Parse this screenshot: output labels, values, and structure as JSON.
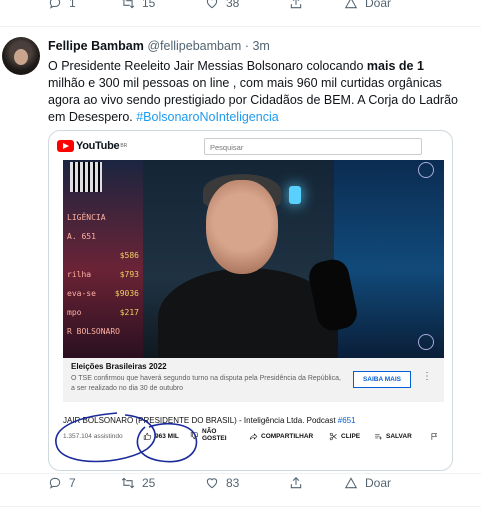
{
  "top_actions": {
    "replies": "1",
    "retweets": "15",
    "likes": "38",
    "donate": "Doar"
  },
  "tweet": {
    "name": "Fellipe Bambam",
    "handle": "@fellipebambam",
    "separator": "·",
    "time": "3m",
    "text_before": "O Presidente Reeleito Jair Messias Bolsonaro colocando ",
    "text_bold": "mais de 1",
    "text_after": " milhão e 300 mil pessoas on line , com mais 960 mil curtidas orgânicas agora ao vivo sendo prestigiado por Cidadãos de BEM. A Corja do Ladrão em Desespero. ",
    "hashtag": "#BolsonaroNoInteligencia"
  },
  "youtube": {
    "logo_text": "YouTube",
    "logo_sup": "BR",
    "search_placeholder": "Pesquisar",
    "video_overlay": {
      "header_lines": [
        "LIGÊNCIA",
        "A. 651"
      ],
      "rows": [
        {
          "label": "",
          "value": "$586"
        },
        {
          "label": "rilha",
          "value": "$793"
        },
        {
          "label": "eva-se",
          "value": "$9036"
        },
        {
          "label": "mpo",
          "value": "$217"
        }
      ],
      "footer": "R BOLSONARO"
    },
    "banner": {
      "title": "Eleições Brasileiras 2022",
      "text": "O TSE confirmou que haverá segundo turno na disputa pela Presidência da República, a ser realizado no dia 30 de outubro",
      "button": "SAIBA MAIS",
      "more": "⋮"
    },
    "video_title": "JAIR BOLSONARO (PRESIDENTE DO BRASIL) - Inteligência Ltda. Podcast ",
    "video_title_tag": "#651",
    "views": "1.357.104 assistindo",
    "like_count": "963 MIL",
    "dislike_label_1": "NÃO",
    "dislike_label_2": "GOSTEI",
    "share_label": "COMPARTILHAR",
    "clip_label": "CLIPE",
    "save_label": "SALVAR"
  },
  "bottom_actions": {
    "replies": "7",
    "retweets": "25",
    "likes": "83",
    "donate": "Doar"
  },
  "colors": {
    "link": "#1d9bf0",
    "youtube_red": "#ff0000",
    "ink": "#1a2a9c"
  }
}
